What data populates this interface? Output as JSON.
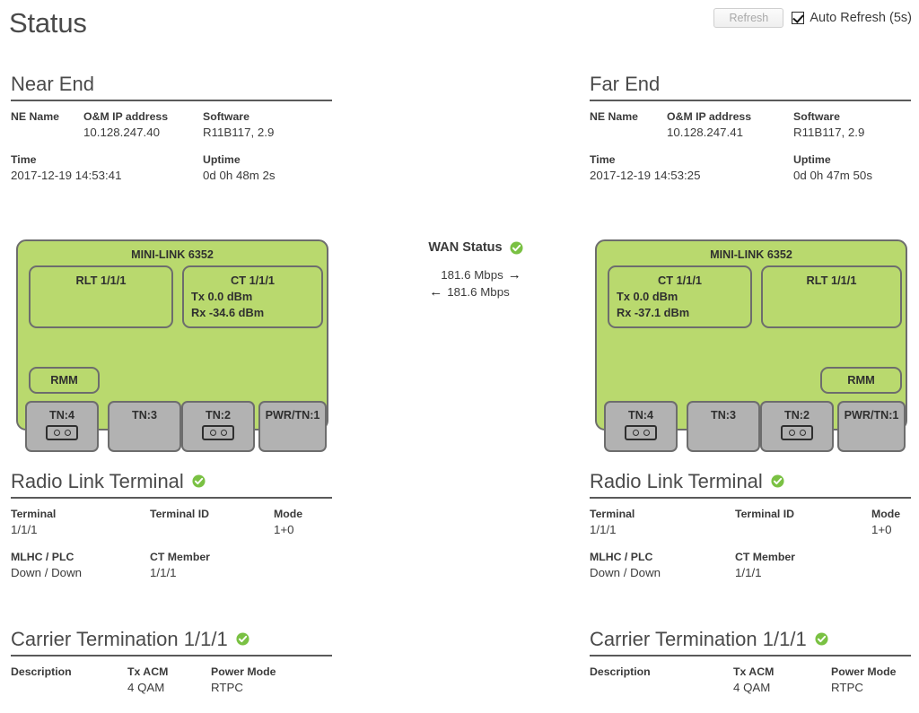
{
  "page": {
    "title": "Status"
  },
  "toolbar": {
    "refresh_label": "Refresh",
    "refresh_disabled": true,
    "auto_refresh_label": "Auto Refresh (5s)",
    "auto_refresh_checked": true
  },
  "status_icon": {
    "name": "check-circle-icon",
    "color": "#78be20",
    "state": "ok"
  },
  "colors": {
    "chassis_green": "#b9d96e",
    "module_gray": "#b2b2b2",
    "outline": "#6d6d6d",
    "ok_green": "#7ac143",
    "text": "#3b3b3b",
    "rule": "#5a5a5a"
  },
  "wan": {
    "title": "WAN Status",
    "downstream_rate": "181.6 Mbps",
    "downstream_arrow": "→",
    "upstream_rate": "181.6 Mbps",
    "upstream_arrow": "←"
  },
  "near_end": {
    "heading": "Near End",
    "info": {
      "labels": [
        "NE Name",
        "O&M IP address",
        "Software"
      ],
      "values": [
        "",
        "10.128.247.40",
        "R11B117, 2.9"
      ],
      "labels2": [
        "Time",
        "Uptime"
      ],
      "values2": [
        "2017-12-19 14:53:41",
        "0d 0h 48m 2s"
      ]
    },
    "device": {
      "model": "MINI-LINK 6352",
      "mirrored": false,
      "rlt_title": "RLT 1/1/1",
      "ct_title": "CT 1/1/1",
      "ct_tx": "Tx 0.0 dBm",
      "ct_rx": "Rx -34.6 dBm",
      "rmm_label": "RMM",
      "modules": [
        {
          "label": "TN:4",
          "connector": true
        },
        {
          "label": "TN:3",
          "connector": false
        },
        {
          "label": "TN:2",
          "connector": true
        },
        {
          "label": "PWR/TN:1",
          "connector": false
        }
      ]
    },
    "rlt_section": {
      "heading": "Radio Link Terminal",
      "labels": [
        "Terminal",
        "Terminal ID",
        "Mode"
      ],
      "values": [
        "1/1/1",
        "",
        "1+0"
      ],
      "labels2": [
        "MLHC / PLC",
        "CT Member"
      ],
      "values2": [
        "Down / Down",
        "1/1/1"
      ]
    },
    "ct_section": {
      "heading": "Carrier Termination 1/1/1",
      "labels": [
        "Description",
        "Tx ACM",
        "Power Mode"
      ],
      "values": [
        "",
        "4 QAM",
        "RTPC"
      ]
    }
  },
  "far_end": {
    "heading": "Far End",
    "info": {
      "labels": [
        "NE Name",
        "O&M IP address",
        "Software"
      ],
      "values": [
        "",
        "10.128.247.41",
        "R11B117, 2.9"
      ],
      "labels2": [
        "Time",
        "Uptime"
      ],
      "values2": [
        "2017-12-19 14:53:25",
        "0d 0h 47m 50s"
      ]
    },
    "device": {
      "model": "MINI-LINK 6352",
      "mirrored": true,
      "rlt_title": "RLT 1/1/1",
      "ct_title": "CT 1/1/1",
      "ct_tx": "Tx 0.0 dBm",
      "ct_rx": "Rx -37.1 dBm",
      "rmm_label": "RMM",
      "modules": [
        {
          "label": "TN:4",
          "connector": true
        },
        {
          "label": "TN:3",
          "connector": false
        },
        {
          "label": "TN:2",
          "connector": true
        },
        {
          "label": "PWR/TN:1",
          "connector": false
        }
      ]
    },
    "rlt_section": {
      "heading": "Radio Link Terminal",
      "labels": [
        "Terminal",
        "Terminal ID",
        "Mode"
      ],
      "values": [
        "1/1/1",
        "",
        "1+0"
      ],
      "labels2": [
        "MLHC / PLC",
        "CT Member"
      ],
      "values2": [
        "Down / Down",
        "1/1/1"
      ]
    },
    "ct_section": {
      "heading": "Carrier Termination 1/1/1",
      "labels": [
        "Description",
        "Tx ACM",
        "Power Mode"
      ],
      "values": [
        "",
        "4 QAM",
        "RTPC"
      ]
    }
  }
}
